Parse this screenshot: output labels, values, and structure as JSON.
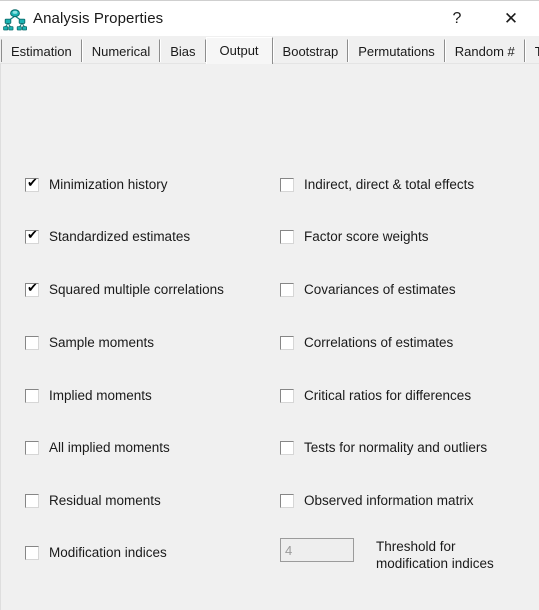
{
  "window": {
    "title": "Analysis Properties",
    "icon": "path-diagram-icon",
    "help_label": "?",
    "close_label": "✕",
    "bg_color": "#f0f0f0",
    "titlebar_color": "#ffffff",
    "icon_color": "#1ab3b3"
  },
  "tabs": [
    {
      "label": "Estimation",
      "selected": false
    },
    {
      "label": "Numerical",
      "selected": false
    },
    {
      "label": "Bias",
      "selected": false
    },
    {
      "label": "Output",
      "selected": true
    },
    {
      "label": "Bootstrap",
      "selected": false
    },
    {
      "label": "Permutations",
      "selected": false
    },
    {
      "label": "Random #",
      "selected": false
    },
    {
      "label": "Title",
      "selected": false
    }
  ],
  "output_tab": {
    "left_column": [
      {
        "label": "Minimization history",
        "checked": true
      },
      {
        "label": "Standardized estimates",
        "checked": true
      },
      {
        "label": "Squared multiple correlations",
        "checked": true
      },
      {
        "label": "Sample moments",
        "checked": false
      },
      {
        "label": "Implied moments",
        "checked": false
      },
      {
        "label": "All implied moments",
        "checked": false
      },
      {
        "label": "Residual moments",
        "checked": false
      },
      {
        "label": "Modification indices",
        "checked": false
      }
    ],
    "right_column": [
      {
        "label": "Indirect, direct & total effects",
        "checked": false
      },
      {
        "label": "Factor score weights",
        "checked": false
      },
      {
        "label": "Covariances of estimates",
        "checked": false
      },
      {
        "label": "Correlations of estimates",
        "checked": false
      },
      {
        "label": "Critical ratios for differences",
        "checked": false
      },
      {
        "label": "Tests for normality and outliers",
        "checked": false
      },
      {
        "label": "Observed information matrix",
        "checked": false
      }
    ],
    "threshold": {
      "value": "4",
      "label": "Threshold for\nmodification indices",
      "enabled": false
    }
  },
  "checkmark_glyph": "✔"
}
